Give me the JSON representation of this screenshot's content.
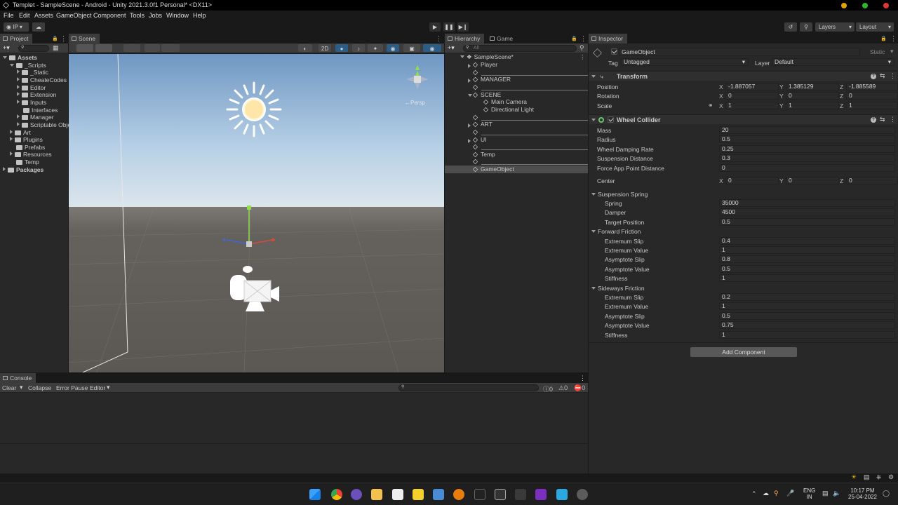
{
  "window": {
    "title": "Templet - SampleScene - Android - Unity 2021.3.0f1 Personal* <DX11>"
  },
  "menu": [
    "File",
    "Edit",
    "Assets",
    "GameObject",
    "Component",
    "Tools",
    "Jobs",
    "Window",
    "Help"
  ],
  "toolbar": {
    "account": "IP",
    "layers": "Layers",
    "layout": "Layout"
  },
  "project": {
    "tab": "Project",
    "tree": [
      {
        "label": "Assets",
        "depth": 0,
        "type": "folder",
        "open": true,
        "bold": true
      },
      {
        "label": "_Scripts",
        "depth": 1,
        "type": "folder",
        "open": true
      },
      {
        "label": "_Static",
        "depth": 2,
        "type": "folder",
        "open": false
      },
      {
        "label": "CheateCodes",
        "depth": 2,
        "type": "folder",
        "open": false
      },
      {
        "label": "Editor",
        "depth": 2,
        "type": "folder",
        "open": false
      },
      {
        "label": "Extension",
        "depth": 2,
        "type": "folder",
        "open": false
      },
      {
        "label": "Inputs",
        "depth": 2,
        "type": "folder",
        "open": false
      },
      {
        "label": "Interfaces",
        "depth": 2,
        "type": "folder",
        "open": null
      },
      {
        "label": "Manager",
        "depth": 2,
        "type": "folder",
        "open": false
      },
      {
        "label": "Scriptable Obje",
        "depth": 2,
        "type": "folder",
        "open": false
      },
      {
        "label": "Art",
        "depth": 1,
        "type": "folder",
        "open": false
      },
      {
        "label": "Plugins",
        "depth": 1,
        "type": "folder",
        "open": false
      },
      {
        "label": "Prefabs",
        "depth": 1,
        "type": "folder",
        "open": null
      },
      {
        "label": "Resources",
        "depth": 1,
        "type": "folder",
        "open": false
      },
      {
        "label": "Temp",
        "depth": 1,
        "type": "folder",
        "open": null
      },
      {
        "label": "Packages",
        "depth": 0,
        "type": "folder",
        "open": false,
        "bold": true
      }
    ]
  },
  "scene": {
    "tab": "Scene",
    "mode2d": "2D",
    "persp": "←Persp"
  },
  "hierarchy": {
    "tab": "Hierarchy",
    "game_tab": "Game",
    "search_placeholder": "All",
    "root": "SampleScene*",
    "items": [
      {
        "label": "Player",
        "depth": 1,
        "fold": true
      },
      {
        "label": "",
        "depth": 1,
        "fold": false,
        "sep": true
      },
      {
        "label": "MANAGER",
        "depth": 1,
        "fold": true
      },
      {
        "label": "",
        "depth": 1,
        "fold": false,
        "sep": true
      },
      {
        "label": "SCENE",
        "depth": 1,
        "fold": "open"
      },
      {
        "label": "Main Camera",
        "depth": 2,
        "fold": false
      },
      {
        "label": "Directional Light",
        "depth": 2,
        "fold": false
      },
      {
        "label": "",
        "depth": 1,
        "fold": false,
        "sep": true
      },
      {
        "label": "ART",
        "depth": 1,
        "fold": true
      },
      {
        "label": "",
        "depth": 1,
        "fold": false,
        "sep": true
      },
      {
        "label": "UI",
        "depth": 1,
        "fold": true
      },
      {
        "label": "",
        "depth": 1,
        "fold": false,
        "sep": true
      },
      {
        "label": "Temp",
        "depth": 1,
        "fold": false
      },
      {
        "label": "",
        "depth": 1,
        "fold": false,
        "sep": true
      },
      {
        "label": "GameObject",
        "depth": 1,
        "fold": false,
        "selected": true
      }
    ]
  },
  "inspector": {
    "tab": "Inspector",
    "object_name": "GameObject",
    "static_label": "Static",
    "tag_label": "Tag",
    "tag_value": "Untagged",
    "layer_label": "Layer",
    "layer_value": "Default",
    "transform": {
      "title": "Transform",
      "rows": [
        {
          "label": "Position",
          "x": "-1.887057",
          "y": "1.385129",
          "z": "-1.885589"
        },
        {
          "label": "Rotation",
          "x": "0",
          "y": "0",
          "z": "0"
        },
        {
          "label": "Scale",
          "x": "1",
          "y": "1",
          "z": "1"
        }
      ]
    },
    "wheel": {
      "title": "Wheel Collider",
      "props": [
        {
          "label": "Mass",
          "value": "20"
        },
        {
          "label": "Radius",
          "value": "0.5"
        },
        {
          "label": "Wheel Damping Rate",
          "value": "0.25"
        },
        {
          "label": "Suspension Distance",
          "value": "0.3"
        },
        {
          "label": "Force App Point Distance",
          "value": "0"
        }
      ],
      "center": {
        "label": "Center",
        "x": "0",
        "y": "0",
        "z": "0"
      },
      "groups": [
        {
          "title": "Suspension Spring",
          "props": [
            {
              "label": "Spring",
              "value": "35000"
            },
            {
              "label": "Damper",
              "value": "4500"
            },
            {
              "label": "Target Position",
              "value": "0.5"
            }
          ]
        },
        {
          "title": "Forward Friction",
          "props": [
            {
              "label": "Extremum Slip",
              "value": "0.4"
            },
            {
              "label": "Extremum Value",
              "value": "1"
            },
            {
              "label": "Asymptote Slip",
              "value": "0.8"
            },
            {
              "label": "Asymptote Value",
              "value": "0.5"
            },
            {
              "label": "Stiffness",
              "value": "1"
            }
          ]
        },
        {
          "title": "Sideways Friction",
          "props": [
            {
              "label": "Extremum Slip",
              "value": "0.2"
            },
            {
              "label": "Extremum Value",
              "value": "1"
            },
            {
              "label": "Asymptote Slip",
              "value": "0.5"
            },
            {
              "label": "Asymptote Value",
              "value": "0.75"
            },
            {
              "label": "Stiffness",
              "value": "1"
            }
          ]
        }
      ]
    },
    "add_component": "Add Component"
  },
  "console": {
    "tab": "Console",
    "clear": "Clear",
    "collapse": "Collapse",
    "error_pause": "Error Pause",
    "editor": "Editor",
    "count_log": "0",
    "count_warn": "0",
    "count_err": "0"
  },
  "taskbar": {
    "lang1": "ENG",
    "lang2": "IN",
    "time": "10:17 PM",
    "date": "25-04-2022"
  },
  "colors": {
    "accent": "#2c5d87",
    "selection": "#4d4d4d",
    "sky": "#8bb3d6",
    "ground": "#5d5954"
  }
}
